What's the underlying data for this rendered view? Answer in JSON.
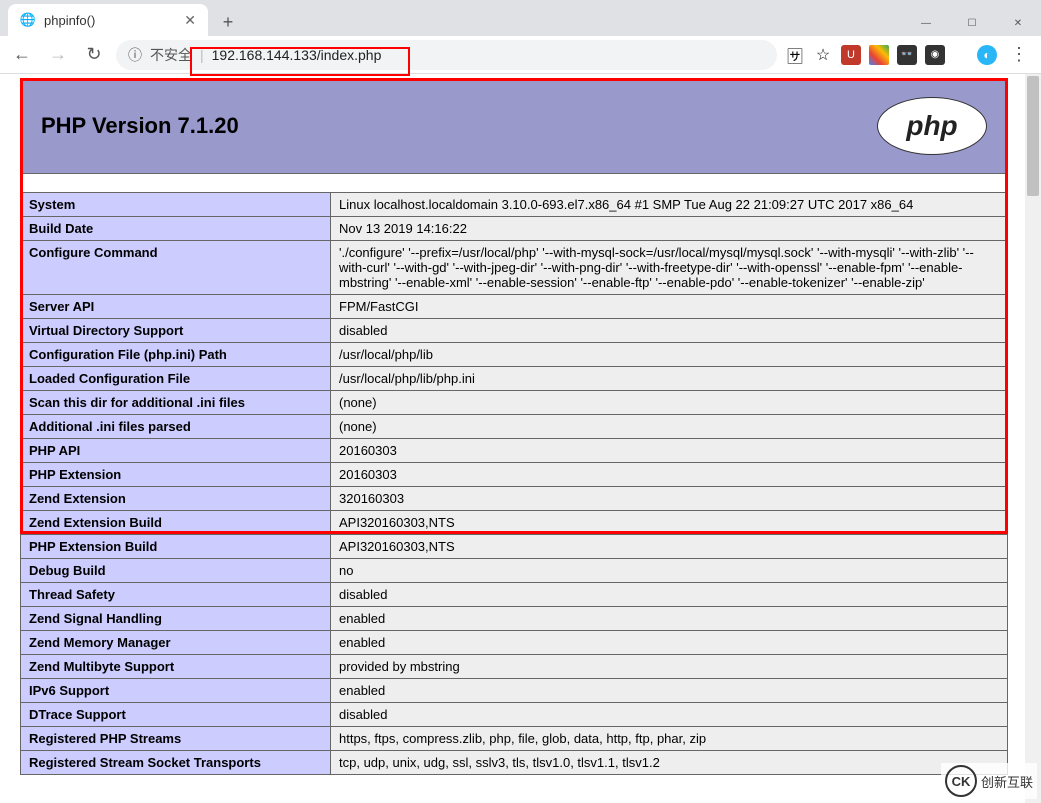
{
  "browser": {
    "tab_title": "phpinfo()",
    "url": "192.168.144.133/index.php",
    "insecure_label": "不安全",
    "nav": {
      "back": "←",
      "forward": "→",
      "reload": "↻"
    },
    "win": {
      "min": "—",
      "max": "☐",
      "close": "✕"
    },
    "new_tab": "+",
    "tab_close": "✕",
    "star": "☆",
    "info_icon": "ⓘ",
    "translate_icon": "🈂",
    "kebab": "⋮"
  },
  "header": {
    "title": "PHP Version 7.1.20",
    "logo_text": "php"
  },
  "rows": [
    {
      "k": "System",
      "v": "Linux localhost.localdomain 3.10.0-693.el7.x86_64 #1 SMP Tue Aug 22 21:09:27 UTC 2017 x86_64"
    },
    {
      "k": "Build Date",
      "v": "Nov 13 2019 14:16:22"
    },
    {
      "k": "Configure Command",
      "v": "'./configure' '--prefix=/usr/local/php' '--with-mysql-sock=/usr/local/mysql/mysql.sock' '--with-mysqli' '--with-zlib' '--with-curl' '--with-gd' '--with-jpeg-dir' '--with-png-dir' '--with-freetype-dir' '--with-openssl' '--enable-fpm' '--enable-mbstring' '--enable-xml' '--enable-session' '--enable-ftp' '--enable-pdo' '--enable-tokenizer' '--enable-zip'"
    },
    {
      "k": "Server API",
      "v": "FPM/FastCGI"
    },
    {
      "k": "Virtual Directory Support",
      "v": "disabled"
    },
    {
      "k": "Configuration File (php.ini) Path",
      "v": "/usr/local/php/lib"
    },
    {
      "k": "Loaded Configuration File",
      "v": "/usr/local/php/lib/php.ini"
    },
    {
      "k": "Scan this dir for additional .ini files",
      "v": "(none)"
    },
    {
      "k": "Additional .ini files parsed",
      "v": "(none)"
    },
    {
      "k": "PHP API",
      "v": "20160303"
    },
    {
      "k": "PHP Extension",
      "v": "20160303"
    },
    {
      "k": "Zend Extension",
      "v": "320160303"
    },
    {
      "k": "Zend Extension Build",
      "v": "API320160303,NTS"
    },
    {
      "k": "PHP Extension Build",
      "v": "API320160303,NTS"
    },
    {
      "k": "Debug Build",
      "v": "no"
    },
    {
      "k": "Thread Safety",
      "v": "disabled"
    },
    {
      "k": "Zend Signal Handling",
      "v": "enabled"
    },
    {
      "k": "Zend Memory Manager",
      "v": "enabled"
    },
    {
      "k": "Zend Multibyte Support",
      "v": "provided by mbstring"
    },
    {
      "k": "IPv6 Support",
      "v": "enabled"
    },
    {
      "k": "DTrace Support",
      "v": "disabled"
    },
    {
      "k": "Registered PHP Streams",
      "v": "https, ftps, compress.zlib, php, file, glob, data, http, ftp, phar, zip"
    },
    {
      "k": "Registered Stream Socket Transports",
      "v": "tcp, udp, unix, udg, ssl, sslv3, tls, tlsv1.0, tlsv1.1, tlsv1.2"
    }
  ],
  "watermark": {
    "logo": "CK",
    "text": "创新互联"
  }
}
